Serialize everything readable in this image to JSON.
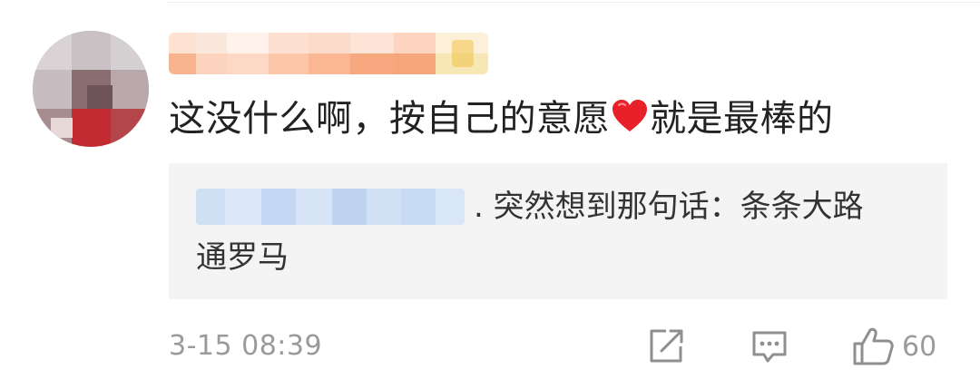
{
  "comment": {
    "text_before_emoji": "这没什么啊，按自己的意愿",
    "emoji": "heart-emoji",
    "text_after_emoji": "就是最棒的"
  },
  "reply": {
    "line1": ". 突然想到那句话：条条大路",
    "line2": "通罗马"
  },
  "footer": {
    "timestamp": "3-15 08:39",
    "like_count": "60"
  },
  "icons": {
    "share": "share-icon",
    "reply": "comment-icon",
    "like": "thumbs-up-icon"
  },
  "colors": {
    "text": "#222222",
    "secondary_text": "#9a9a9a",
    "reply_bg": "#f4f4f4",
    "heart": "#e8202a"
  }
}
